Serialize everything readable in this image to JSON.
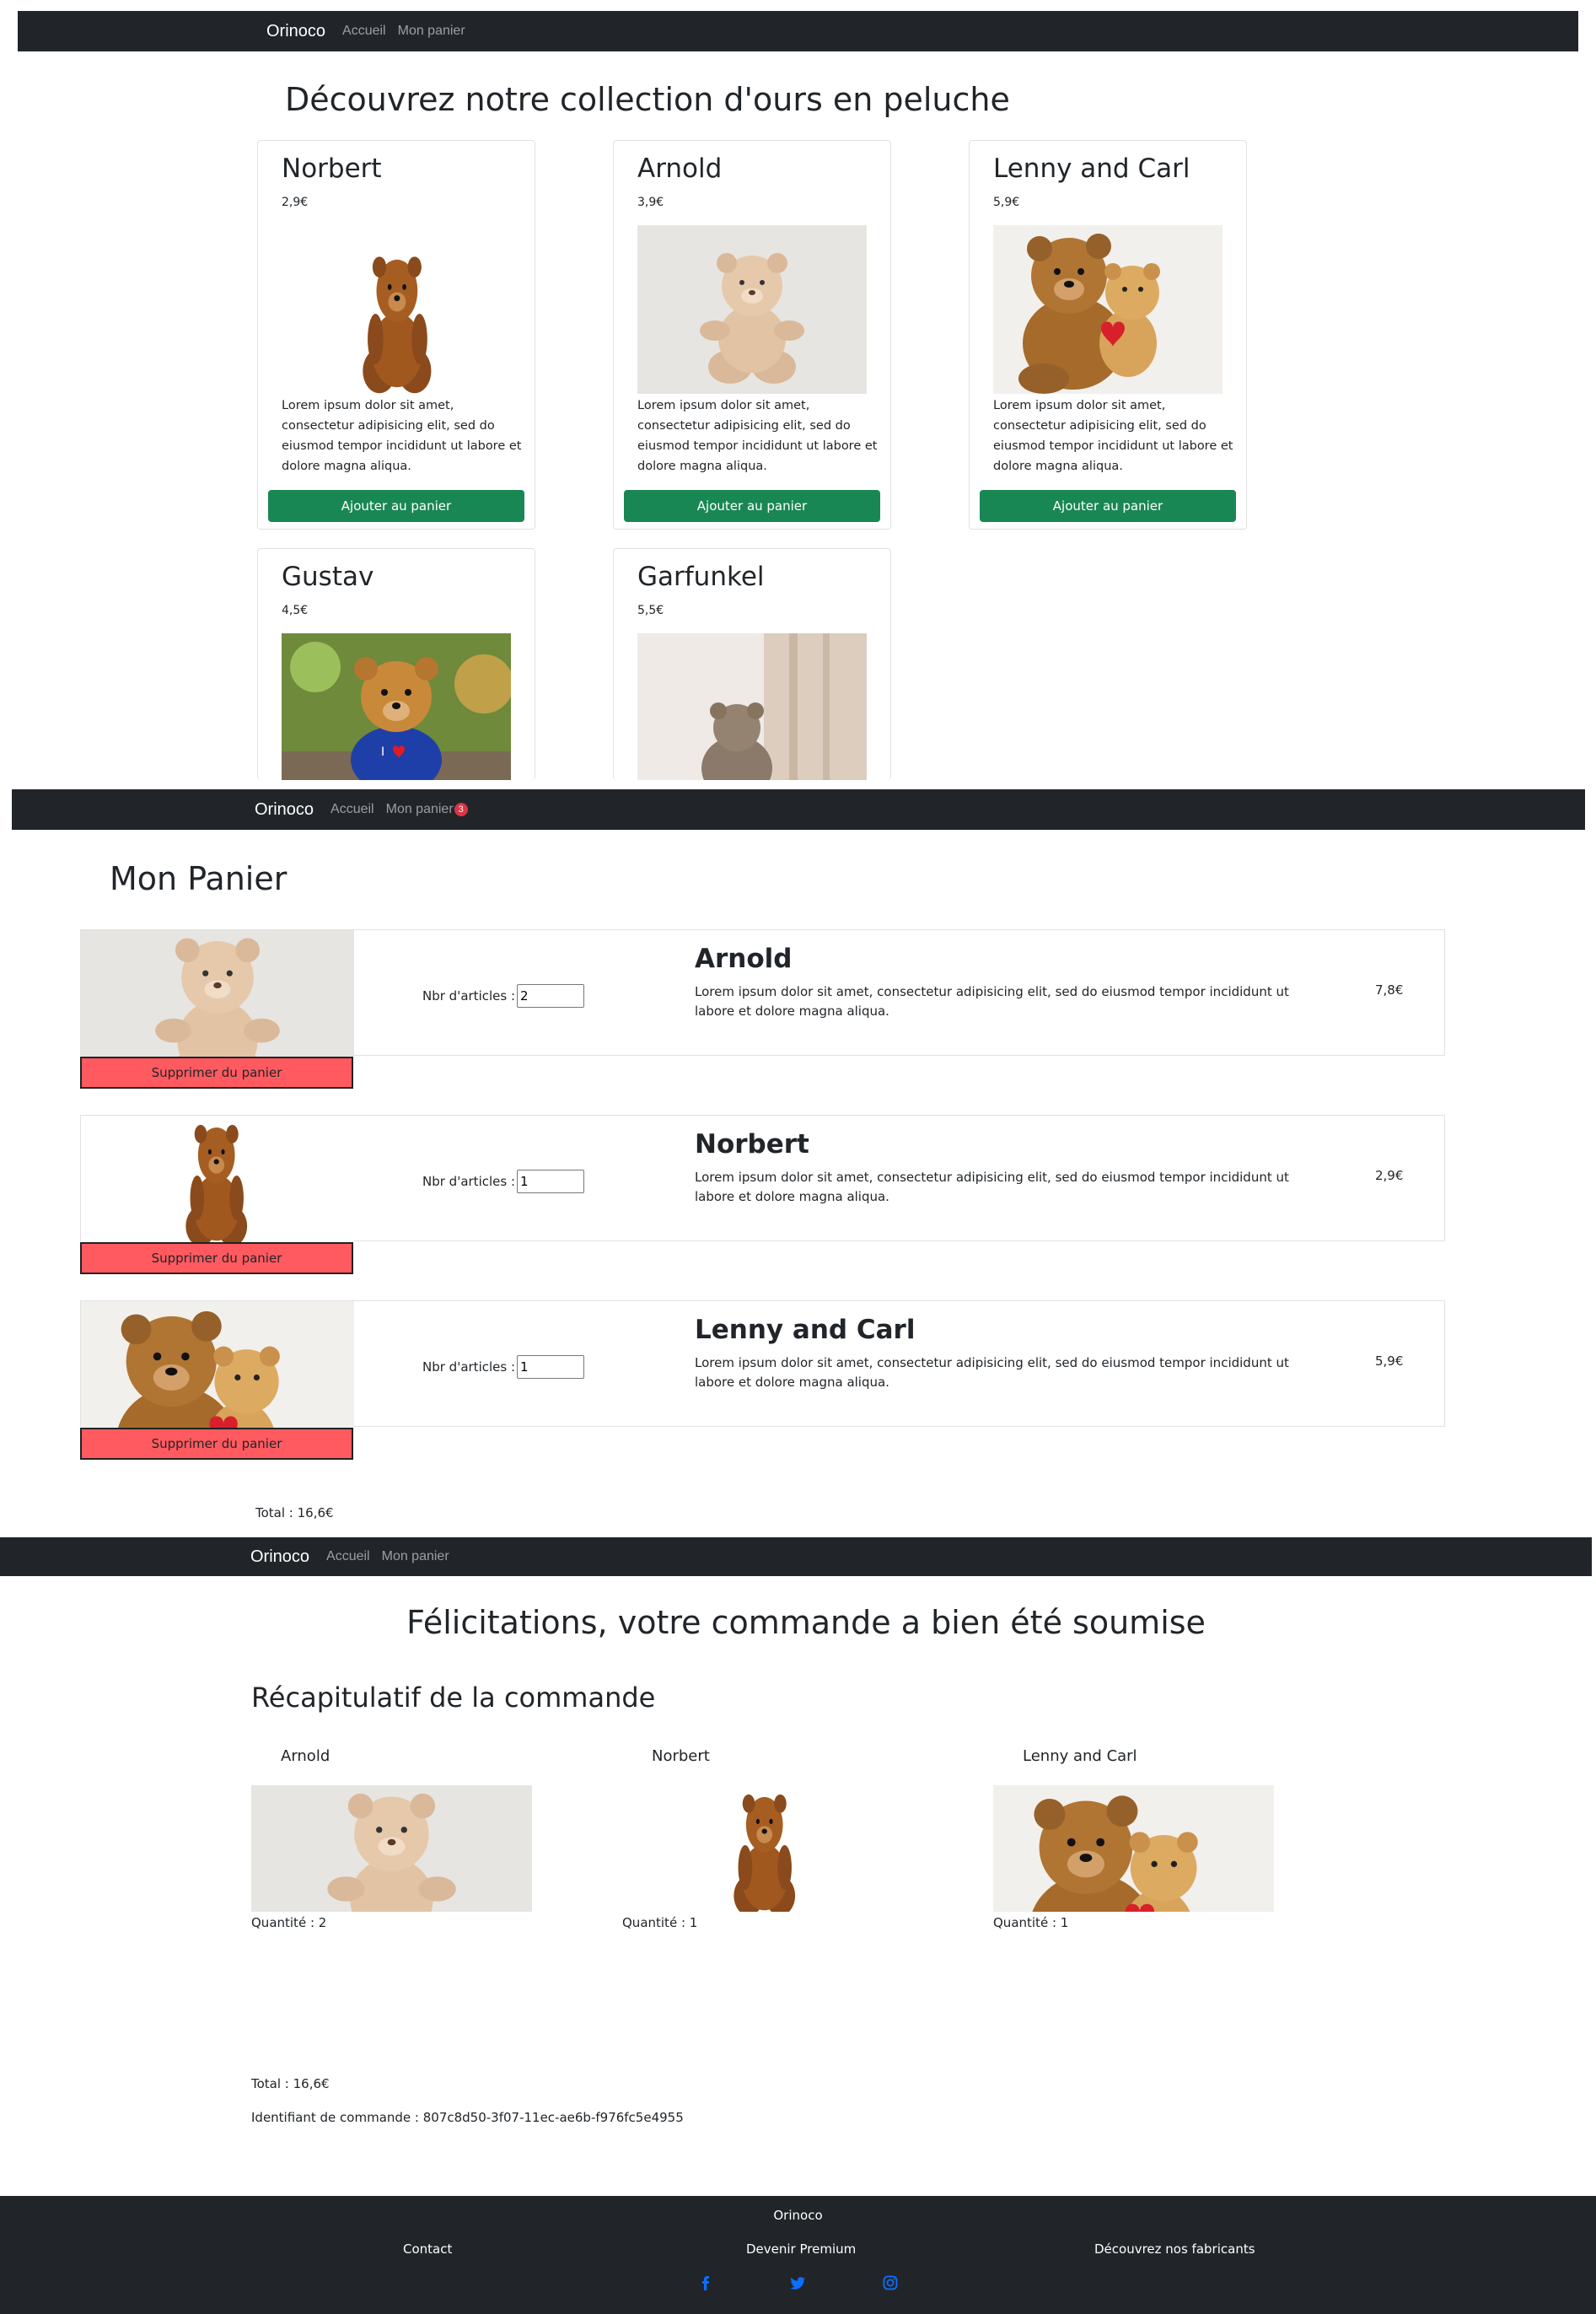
{
  "colors": {
    "nav_bg": "#212529",
    "primary_button": "#198754",
    "remove_button": "#ff5a5f",
    "badge": "#dc3545",
    "social_icon": "#0d6efd"
  },
  "nav": {
    "brand": "Orinoco",
    "home": "Accueil",
    "cart": "Mon panier",
    "cart_badge": "3"
  },
  "catalog": {
    "heading": "Découvrez notre collection d'ours en peluche",
    "add_label": "Ajouter au panier",
    "products": [
      {
        "name": "Norbert",
        "price": "2,9€",
        "description": "Lorem ipsum dolor sit amet, consectetur adipisicing elit, sed do eiusmod tempor incididunt ut labore et dolore magna aliqua."
      },
      {
        "name": "Arnold",
        "price": "3,9€",
        "description": "Lorem ipsum dolor sit amet, consectetur adipisicing elit, sed do eiusmod tempor incididunt ut labore et dolore magna aliqua."
      },
      {
        "name": "Lenny and Carl",
        "price": "5,9€",
        "description": "Lorem ipsum dolor sit amet, consectetur adipisicing elit, sed do eiusmod tempor incididunt ut labore et dolore magna aliqua."
      },
      {
        "name": "Gustav",
        "price": "4,5€"
      },
      {
        "name": "Garfunkel",
        "price": "5,5€"
      }
    ]
  },
  "cart": {
    "heading": "Mon Panier",
    "qty_label": "Nbr d'articles :",
    "remove_label": "Supprimer du panier",
    "items": [
      {
        "name": "Arnold",
        "quantity": "2",
        "price": "7,8€",
        "description": "Lorem ipsum dolor sit amet, consectetur adipisicing elit, sed do eiusmod tempor incididunt ut labore et dolore magna aliqua."
      },
      {
        "name": "Norbert",
        "quantity": "1",
        "price": "2,9€",
        "description": "Lorem ipsum dolor sit amet, consectetur adipisicing elit, sed do eiusmod tempor incididunt ut labore et dolore magna aliqua."
      },
      {
        "name": "Lenny and Carl",
        "quantity": "1",
        "price": "5,9€",
        "description": "Lorem ipsum dolor sit amet, consectetur adipisicing elit, sed do eiusmod tempor incididunt ut labore et dolore magna aliqua."
      }
    ],
    "total": "Total : 16,6€"
  },
  "confirmation": {
    "heading": "Félicitations, votre commande a bien été soumise",
    "summary_heading": "Récapitulatif de la commande",
    "items": [
      {
        "name": "Arnold",
        "quantity": "Quantité : 2"
      },
      {
        "name": "Norbert",
        "quantity": "Quantité : 1"
      },
      {
        "name": "Lenny and Carl",
        "quantity": "Quantité : 1"
      }
    ],
    "total": "Total : 16,6€",
    "order_id": "Identifiant de commande : 807c8d50-3f07-11ec-ae6b-f976fc5e4955"
  },
  "footer": {
    "brand": "Orinoco",
    "links": [
      "Contact",
      "Devenir Premium",
      "Découvrez nos fabricants"
    ],
    "social_icons": [
      "facebook-icon",
      "twitter-icon",
      "instagram-icon"
    ]
  }
}
